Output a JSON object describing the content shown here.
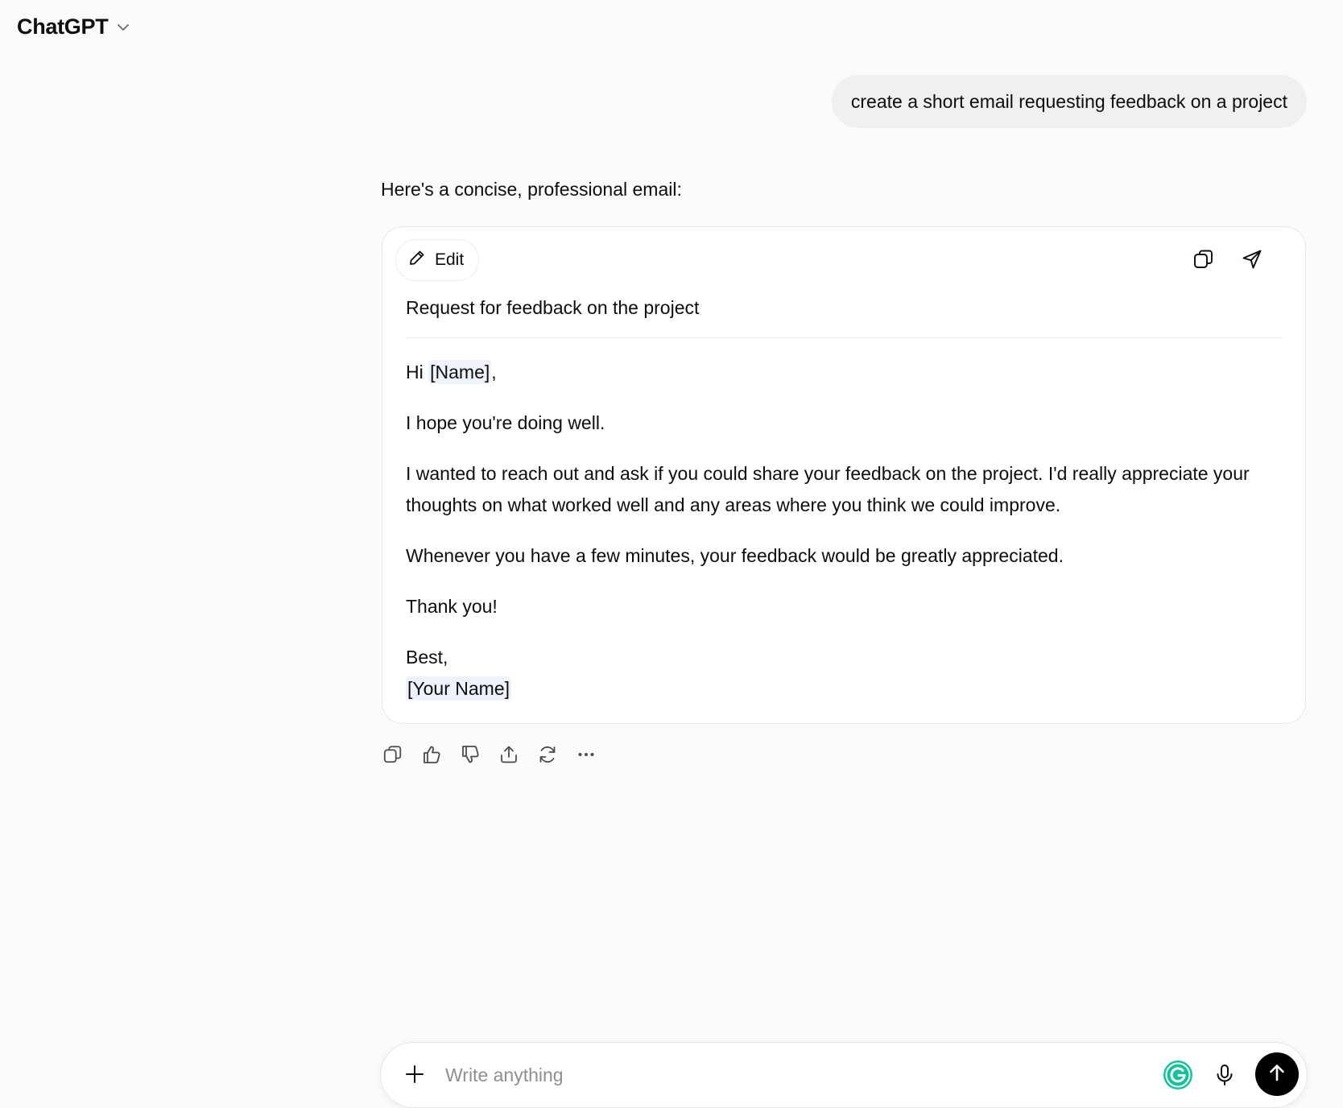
{
  "header": {
    "title": "ChatGPT",
    "dropdown_icon": "chevron-down-icon"
  },
  "conversation": {
    "user_message": "create a short email requesting feedback on a project",
    "assistant_intro": "Here's a concise, professional email:",
    "canvas": {
      "edit_label": "Edit",
      "subject": "Request for feedback on the project",
      "greeting_prefix": "Hi ",
      "greeting_placeholder": "[Name]",
      "greeting_suffix": ",",
      "paragraphs": [
        "I hope you're doing well.",
        "I wanted to reach out and ask if you could share your feedback on the project. I'd really appreciate your thoughts on what worked well and any areas where you think we could improve.",
        "Whenever you have a few minutes, your feedback would be greatly appreciated.",
        "Thank you!"
      ],
      "signoff": "Best,",
      "signature_placeholder": "[Your Name]",
      "toolbar_icons": [
        "copy-icon",
        "send-email-icon"
      ]
    },
    "message_actions": [
      "copy-icon",
      "thumbs-up-icon",
      "thumbs-down-icon",
      "share-icon",
      "regenerate-icon",
      "more-icon"
    ]
  },
  "composer": {
    "placeholder": "Write anything",
    "value": "",
    "icons": [
      "plus-icon",
      "grammarly-icon",
      "microphone-icon",
      "send-arrow-icon"
    ]
  },
  "colors": {
    "background": "#fbfbfb",
    "bubble": "#f0f0f0",
    "placeholder_highlight": "#eef2fb",
    "send_button": "#000000",
    "grammarly": "#15c39a"
  }
}
